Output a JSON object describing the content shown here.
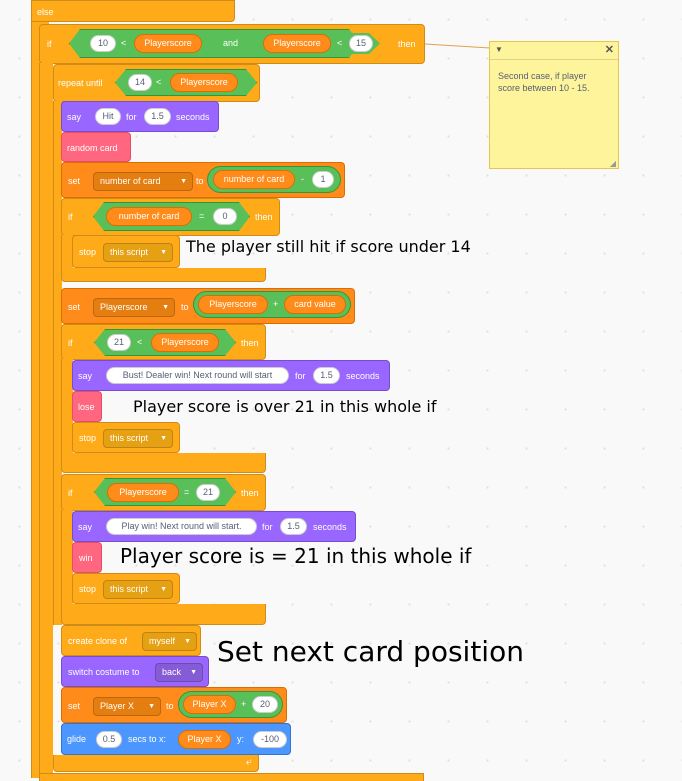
{
  "blocks": {
    "else_label": "else",
    "if1": {
      "kw": "if",
      "n1": "10",
      "lt": "<",
      "v1": "Playerscore",
      "and": "and",
      "v2": "Playerscore",
      "lt2": "<",
      "n2": "15",
      "then": "then"
    },
    "repeat": {
      "kw": "repeat until",
      "n": "14",
      "lt": "<",
      "v": "Playerscore"
    },
    "say1": {
      "kw": "say",
      "msg": "Hit",
      "for": "for",
      "secs": "1.5",
      "seconds": "seconds"
    },
    "random_card": "random card",
    "set1": {
      "kw": "set",
      "var": "number of card",
      "to": "to",
      "v": "number of card",
      "minus": "-",
      "n": "1"
    },
    "if2": {
      "kw": "if",
      "v": "number of card",
      "eq": "=",
      "n": "0",
      "then": "then"
    },
    "stop1": {
      "kw": "stop",
      "opt": "this script"
    },
    "set2": {
      "kw": "set",
      "var": "Playerscore",
      "to": "to",
      "v1": "Playerscore",
      "plus": "+",
      "v2": "card value"
    },
    "if3": {
      "kw": "if",
      "n": "21",
      "lt": "<",
      "v": "Playerscore",
      "then": "then"
    },
    "say2": {
      "kw": "say",
      "msg": "Bust! Dealer win! Next round will start",
      "for": "for",
      "secs": "1.5",
      "seconds": "seconds"
    },
    "lose": "lose",
    "stop2": {
      "kw": "stop",
      "opt": "this script"
    },
    "if4": {
      "kw": "if",
      "v": "Playerscore",
      "eq": "=",
      "n": "21",
      "then": "then"
    },
    "say3": {
      "kw": "say",
      "msg": "Play win! Next round will start.",
      "for": "for",
      "secs": "1.5",
      "seconds": "seconds"
    },
    "win": "win",
    "stop3": {
      "kw": "stop",
      "opt": "this script"
    },
    "clone": {
      "kw": "create clone of",
      "opt": "myself"
    },
    "costume": {
      "kw": "switch costume to",
      "opt": "back"
    },
    "set3": {
      "kw": "set",
      "var": "Player X",
      "to": "to",
      "v": "Player X",
      "plus": "+",
      "n": "20"
    },
    "glide": {
      "kw": "glide",
      "secs": "0.5",
      "secs_to": "secs to x:",
      "x": "Player X",
      "y_lbl": "y:",
      "y": "-100"
    }
  },
  "annotations": {
    "a1": "The player still hit if score under 14",
    "a2": "Player score is over 21 in this whole if",
    "a3": "Player score is = 21 in this whole if",
    "a4": "Set next card position"
  },
  "sticky_note": {
    "text": "Second case, if player score between 10 - 15.",
    "collapse_icon": "triangle-down",
    "close_icon": "x",
    "color": "#fef49c"
  },
  "colors": {
    "control": "#ffab19",
    "variables": "#ff8c1a",
    "operators": "#59c059",
    "looks": "#9966ff",
    "motion": "#4c97ff",
    "events": "#ff6680"
  }
}
